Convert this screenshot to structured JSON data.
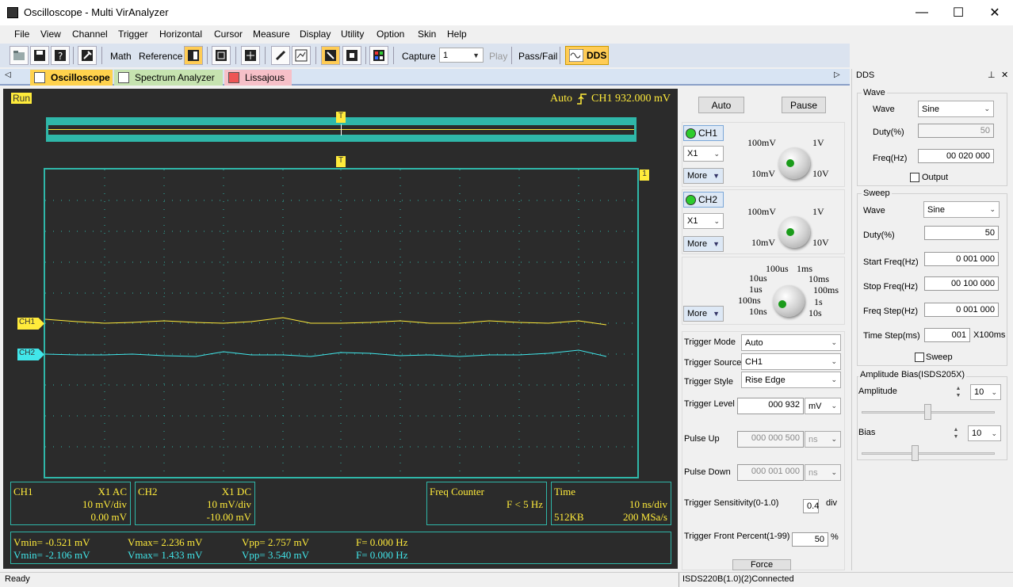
{
  "window": {
    "title": "Oscilloscope - Multi VirAnalyzer",
    "min": "—",
    "max": "☐",
    "close": "✕"
  },
  "menu": [
    "File",
    "View",
    "Channel",
    "Trigger",
    "Horizontal",
    "Cursor",
    "Measure",
    "Display",
    "Utility",
    "Option",
    "Skin",
    "Help"
  ],
  "toolbar": {
    "math": "Math",
    "reference": "Reference",
    "capture": "Capture",
    "capture_value": "1",
    "play": "Play",
    "passfail": "Pass/Fail",
    "dds": "DDS"
  },
  "tabs": [
    "Oscilloscope",
    "Spectrum Analyzer",
    "Lissajous"
  ],
  "scope": {
    "status": "Run",
    "trigger_mode": "Auto",
    "trigger_info": "CH1 932.000 mV",
    "trigger_marker": "T",
    "level_marker": "1",
    "ch1_marker": "CH1",
    "ch2_marker": "CH2",
    "ch1_box": {
      "name": "CH1",
      "coupling": "X1  AC",
      "scale": "10 mV/div",
      "offset": "0.00 mV"
    },
    "ch2_box": {
      "name": "CH2",
      "coupling": "X1  DC",
      "scale": "10 mV/div",
      "offset": "-10.00 mV"
    },
    "freq_box": {
      "title": "Freq Counter",
      "value": "F < 5 Hz"
    },
    "time_box": {
      "title": "Time",
      "scale": "10 ns/div",
      "mem": "512KB",
      "rate": "200 MSa/s"
    },
    "meas1": {
      "vmin": "Vmin= -0.521 mV",
      "vmax": "Vmax= 2.236 mV",
      "vpp": "Vpp= 2.757 mV",
      "f": "F= 0.000 Hz"
    },
    "meas2": {
      "vmin": "Vmin= -2.106 mV",
      "vmax": "Vmax= 1.433 mV",
      "vpp": "Vpp= 3.540 mV",
      "f": "F= 0.000 Hz"
    }
  },
  "controls": {
    "auto": "Auto",
    "pause": "Pause",
    "ch1": "CH1",
    "ch2": "CH2",
    "probe1": "X1",
    "probe2": "X1",
    "more": "More",
    "volt_knob": {
      "tl": "100mV",
      "tr": "1V",
      "bl": "10mV",
      "br": "10V"
    },
    "time_knob": {
      "l1": "100us",
      "l1b": "1ms",
      "l2": "10us",
      "l2b": "10ms",
      "l3": "1us",
      "l3b": "100ms",
      "l4": "100ns",
      "l4b": "1s",
      "l5": "10ns",
      "l5b": "10s"
    },
    "trigger_mode_label": "Trigger Mode",
    "trigger_mode": "Auto",
    "trigger_source_label": "Trigger Source",
    "trigger_source": "CH1",
    "trigger_style_label": "Trigger Style",
    "trigger_style": "Rise Edge",
    "trigger_level_label": "Trigger Level",
    "trigger_level": "000 932",
    "trigger_level_unit": "mV",
    "pulse_up_label": "Pulse Up",
    "pulse_up": "000 000 500",
    "pulse_up_unit": "ns",
    "pulse_down_label": "Pulse Down",
    "pulse_down": "000 001 000",
    "pulse_down_unit": "ns",
    "sens_label": "Trigger Sensitivity(0-1.0)",
    "sens": "0.4",
    "sens_unit": "div",
    "front_label": "Trigger Front Percent(1-99)",
    "front": "50",
    "front_unit": "%",
    "force": "Force"
  },
  "dds": {
    "title": "DDS",
    "pin": "⊥",
    "close": "✕",
    "wave_group": "Wave",
    "wave_label": "Wave",
    "wave": "Sine",
    "duty_label": "Duty(%)",
    "duty": "50",
    "freq_label": "Freq(Hz)",
    "freq": "00 020 000",
    "output": "Output",
    "sweep_group": "Sweep",
    "s_wave_label": "Wave",
    "s_wave": "Sine",
    "s_duty_label": "Duty(%)",
    "s_duty": "50",
    "start_label": "Start Freq(Hz)",
    "start": "0 001 000",
    "stop_label": "Stop Freq(Hz)",
    "stop": "00 100 000",
    "step_label": "Freq Step(Hz)",
    "step": "0 001 000",
    "tstep_label": "Time Step(ms)",
    "tstep": "001",
    "tstep_unit": "X100ms",
    "sweep": "Sweep",
    "amp_group": "Amplitude Bias(ISDS205X)",
    "amp_label": "Amplitude",
    "amp": "10",
    "bias_label": "Bias",
    "bias": "10"
  },
  "status": {
    "left": "Ready",
    "right": "ISDS220B(1.0)(2)Connected"
  },
  "colors": {
    "ch1": "#ffeb3b",
    "ch2": "#41e6ea",
    "grid": "#2fb7a9",
    "screen": "#2b2b2b"
  }
}
